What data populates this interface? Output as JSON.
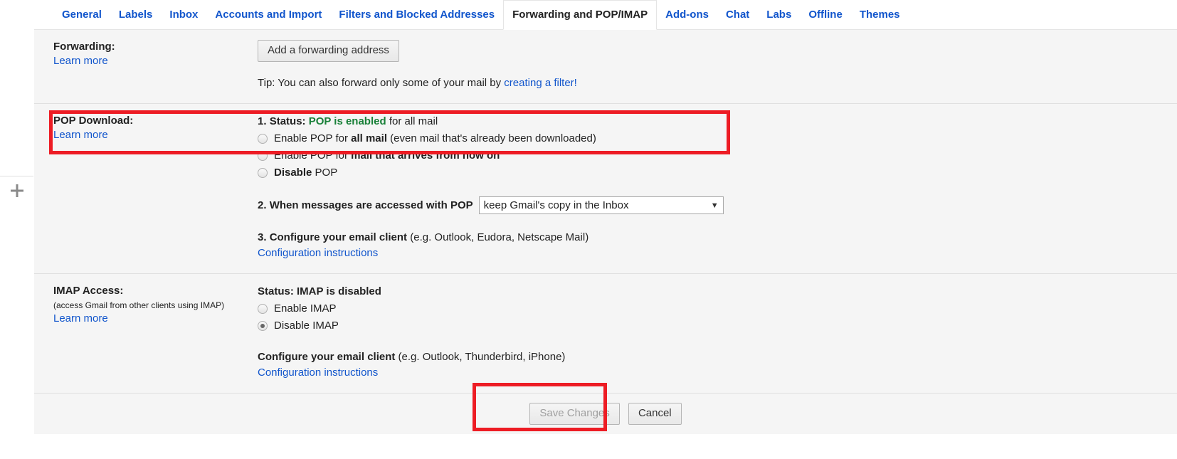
{
  "left_rail": {
    "add_icon": "plus-icon"
  },
  "tabs": [
    {
      "label": "General",
      "active": false
    },
    {
      "label": "Labels",
      "active": false
    },
    {
      "label": "Inbox",
      "active": false
    },
    {
      "label": "Accounts and Import",
      "active": false
    },
    {
      "label": "Filters and Blocked Addresses",
      "active": false
    },
    {
      "label": "Forwarding and POP/IMAP",
      "active": true
    },
    {
      "label": "Add-ons",
      "active": false
    },
    {
      "label": "Chat",
      "active": false
    },
    {
      "label": "Labs",
      "active": false
    },
    {
      "label": "Offline",
      "active": false
    },
    {
      "label": "Themes",
      "active": false
    }
  ],
  "forwarding": {
    "title": "Forwarding:",
    "learn_more": "Learn more",
    "add_button": "Add a forwarding address",
    "tip_prefix": "Tip: You can also forward only some of your mail by ",
    "tip_link": "creating a filter!"
  },
  "pop": {
    "title": "POP Download:",
    "learn_more": "Learn more",
    "status_number": "1.",
    "status_label": "Status:",
    "status_value": "POP is enabled",
    "status_suffix": "for all mail",
    "status_color": "#188038",
    "options": [
      {
        "prefix": "Enable POP for ",
        "bold": "all mail",
        "suffix": " (even mail that's already been downloaded)",
        "checked": false
      },
      {
        "prefix": "Enable POP for ",
        "bold": "mail that arrives from now on",
        "suffix": "",
        "checked": false
      },
      {
        "prefix": "",
        "bold": "Disable",
        "suffix": " POP",
        "checked": false
      }
    ],
    "access_number": "2.",
    "access_label": "When messages are accessed with POP",
    "access_selected": "keep Gmail's copy in the Inbox",
    "access_caret": "▼",
    "configure_number": "3.",
    "configure_label": "Configure your email client",
    "configure_hint": "(e.g. Outlook, Eudora, Netscape Mail)",
    "configure_link": "Configuration instructions"
  },
  "imap": {
    "title": "IMAP Access:",
    "note": "(access Gmail from other clients using IMAP)",
    "learn_more": "Learn more",
    "status": "Status: IMAP is disabled",
    "options": [
      {
        "label": "Enable IMAP",
        "checked": false
      },
      {
        "label": "Disable IMAP",
        "checked": true
      }
    ],
    "configure_label": "Configure your email client",
    "configure_hint": "(e.g. Outlook, Thunderbird, iPhone)",
    "configure_link": "Configuration instructions"
  },
  "footer": {
    "save_label": "Save Changes",
    "save_disabled": true,
    "cancel_label": "Cancel"
  },
  "annotations": {
    "highlight_color": "#ed1c24",
    "boxes": [
      "pop-download-section",
      "save-changes-button"
    ]
  }
}
